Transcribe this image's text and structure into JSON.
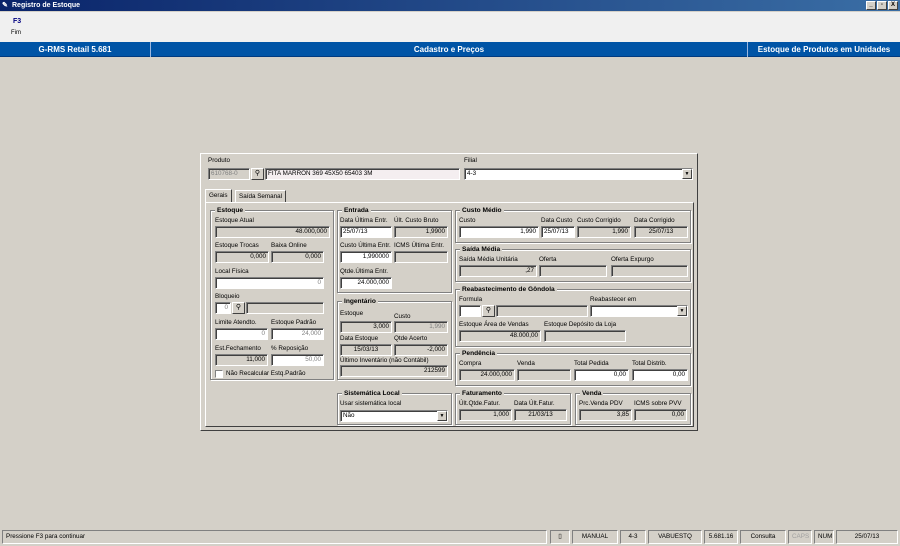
{
  "window": {
    "title": "Registro de Estoque",
    "controls": [
      "_",
      "▫",
      "X"
    ]
  },
  "menu": {
    "key": "F3",
    "label": "Fim"
  },
  "header": {
    "app": "G-RMS Retail 5.681",
    "section": "Cadastro e Preços",
    "module": "Estoque de Produtos em Unidades"
  },
  "produto": {
    "label": "Produto",
    "code": "610768-0",
    "description": "FITA MARRON 369 45X50 65403 3M",
    "search_icon": "binoculars-icon"
  },
  "filial": {
    "label": "Filial",
    "value": "4-3"
  },
  "tabs": [
    {
      "label": "Gerais"
    },
    {
      "label": "Saída Semanal"
    }
  ],
  "estoque": {
    "title": "Estoque",
    "atual_label": "Estoque Atual",
    "atual": "48.000,000",
    "trocas_label": "Estoque Trocas",
    "trocas": "0,000",
    "baixa_label": "Baixa Online",
    "baixa": "0,000",
    "local_label": "Local Física",
    "local": "0",
    "bloqueio_label": "Bloqueio",
    "bloqueio": "0",
    "bloqueio_desc": "",
    "limite_label": "Limite Atendto.",
    "limite": "0",
    "padrao_label": "Estoque Padrão",
    "padrao": "24,000",
    "fechamento_label": "Est.Fechamento",
    "fechamento": "11,000",
    "reposicao_label": "% Reposição",
    "reposicao": "50,00",
    "nao_recalcular_label": "Não Recalcular Estq.Padrão"
  },
  "entrada": {
    "title": "Entrada",
    "data_label": "Data Última Entr.",
    "data": "25/07/13",
    "custo_bruto_label": "Últ. Custo Bruto",
    "custo_bruto": "1,9900",
    "custo_label": "Custo Última Entr.",
    "custo": "1,990000",
    "icms_label": "ICMS Última Entr.",
    "icms": "",
    "qtde_label": "Qtde.Última Entr.",
    "qtde": "24.000,000"
  },
  "inventario": {
    "title": "Ingentário",
    "estoque_label": "Estoque",
    "estoque": "3,000",
    "custo_label": "Custo",
    "custo": "1,990",
    "data_label": "Data Estoque",
    "data": "15/03/13",
    "acerto_label": "Qtde Acerto",
    "acerto": "-2,000",
    "ultimo_label": "Último Inventário (não Contábil)",
    "ultimo": "212599"
  },
  "sistematica": {
    "title": "Sistemática Local",
    "usar_label": "Usar sistemática local",
    "usar": "Não"
  },
  "custo_medio": {
    "title": "Custo Médio",
    "custo_label": "Custo",
    "custo": "1,990",
    "data_label": "Data Custo",
    "data": "25/07/13",
    "corrigido_label": "Custo Corrigido",
    "corrigido": "1,990",
    "data_corrigido_label": "Data Corrigido",
    "data_corrigido": "25/07/13"
  },
  "saida_media": {
    "title": "Saída Média",
    "unitaria_label": "Saída Média Unitária",
    "unitaria": ",27",
    "oferta_label": "Oferta",
    "oferta": "",
    "expurgo_label": "Oferta Expurgo",
    "expurgo": ""
  },
  "reabastecimento": {
    "title": "Reabastecimento de Gôndola",
    "formula_label": "Formula",
    "formula": "",
    "reabastecer_label": "Reabastecer em",
    "reabastecer": "",
    "area_label": "Estoque Área de Vendas",
    "area": "48.000,00",
    "deposito_label": "Estoque Depósito da Loja",
    "deposito": ""
  },
  "pendencia": {
    "title": "Pendência",
    "compra_label": "Compra",
    "compra": "24.000,000",
    "venda_label": "Venda",
    "venda": "",
    "total_pedida_label": "Total Pedida",
    "total_pedida": "0,00",
    "total_distrib_label": "Total  Distrib.",
    "total_distrib": "0,00"
  },
  "faturamento": {
    "title": "Faturamento",
    "qtde_label": "Últ.Qtde.Fatur.",
    "qtde": "1,000",
    "data_label": "Data Últ.Fatur.",
    "data": "21/03/13"
  },
  "venda": {
    "title": "Venda",
    "prc_label": "Prc.Venda PDV",
    "prc": "3,85",
    "icms_label": "ICMS sobre PVV",
    "icms": "0,00"
  },
  "status": {
    "message": "Pressione F3 para continuar",
    "mode": "MANUAL",
    "filial": "4-3",
    "program": "VABUESTQ",
    "version": "5.681.16",
    "operation": "Consulta",
    "caps": "CAPS",
    "num": "NUM",
    "date": "25/07/13"
  }
}
